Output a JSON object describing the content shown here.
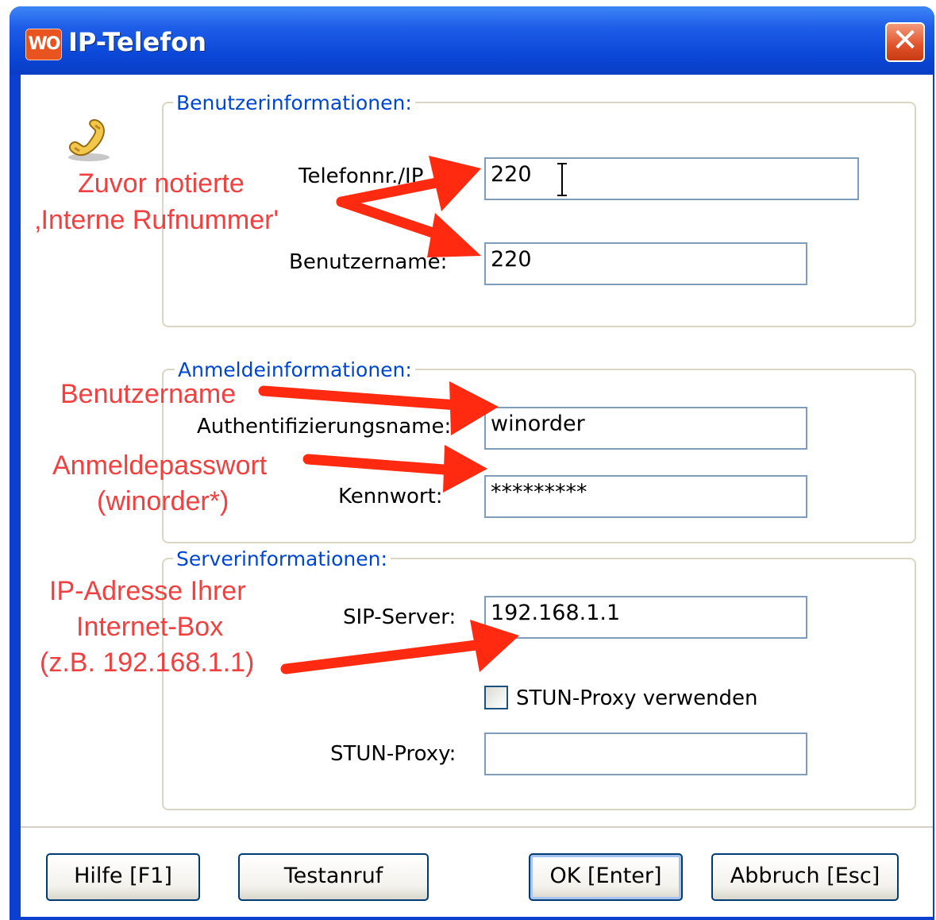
{
  "window": {
    "title": "IP-Telefon",
    "logo_text": "WO",
    "close_symbol": "✕"
  },
  "groups": {
    "user_info": {
      "legend": "Benutzerinformationen:",
      "phone_label": "Telefonnr./IP",
      "phone_value": "220",
      "username_label": "Benutzername:",
      "username_value": "220"
    },
    "login_info": {
      "legend": "Anmeldeinformationen:",
      "auth_label": "Authentifizierungsname:",
      "auth_value": "winorder",
      "password_label": "Kennwort:",
      "password_value": "*********"
    },
    "server_info": {
      "legend": "Serverinformationen:",
      "sip_label": "SIP-Server:",
      "sip_value": "192.168.1.1",
      "stun_checkbox_label": "STUN-Proxy verwenden",
      "stun_checked": false,
      "stun_proxy_label": "STUN-Proxy:",
      "stun_proxy_value": ""
    }
  },
  "buttons": {
    "help": "Hilfe [F1]",
    "test_call": "Testanruf",
    "ok": "OK [Enter]",
    "cancel": "Abbruch [Esc]"
  },
  "annotations": {
    "note1_line1": "Zuvor notierte",
    "note1_line2": "‚Interne Rufnummer'",
    "note2": "Benutzername",
    "note3_line1": "Anmeldepasswort",
    "note3_line2": "(winorder*)",
    "note4_line1": "IP-Adresse Ihrer",
    "note4_line2": "Internet-Box",
    "note4_line3": "(z.B. 192.168.1.1)"
  },
  "colors": {
    "title_bar": "#0b48d8",
    "legend_text": "#0046d5",
    "annotation": "#f04040",
    "arrow": "#ff2a10"
  },
  "icons": {
    "app": "winorder-logo-icon",
    "phone": "telephone-handset-icon",
    "cursor": "text-cursor-icon"
  }
}
